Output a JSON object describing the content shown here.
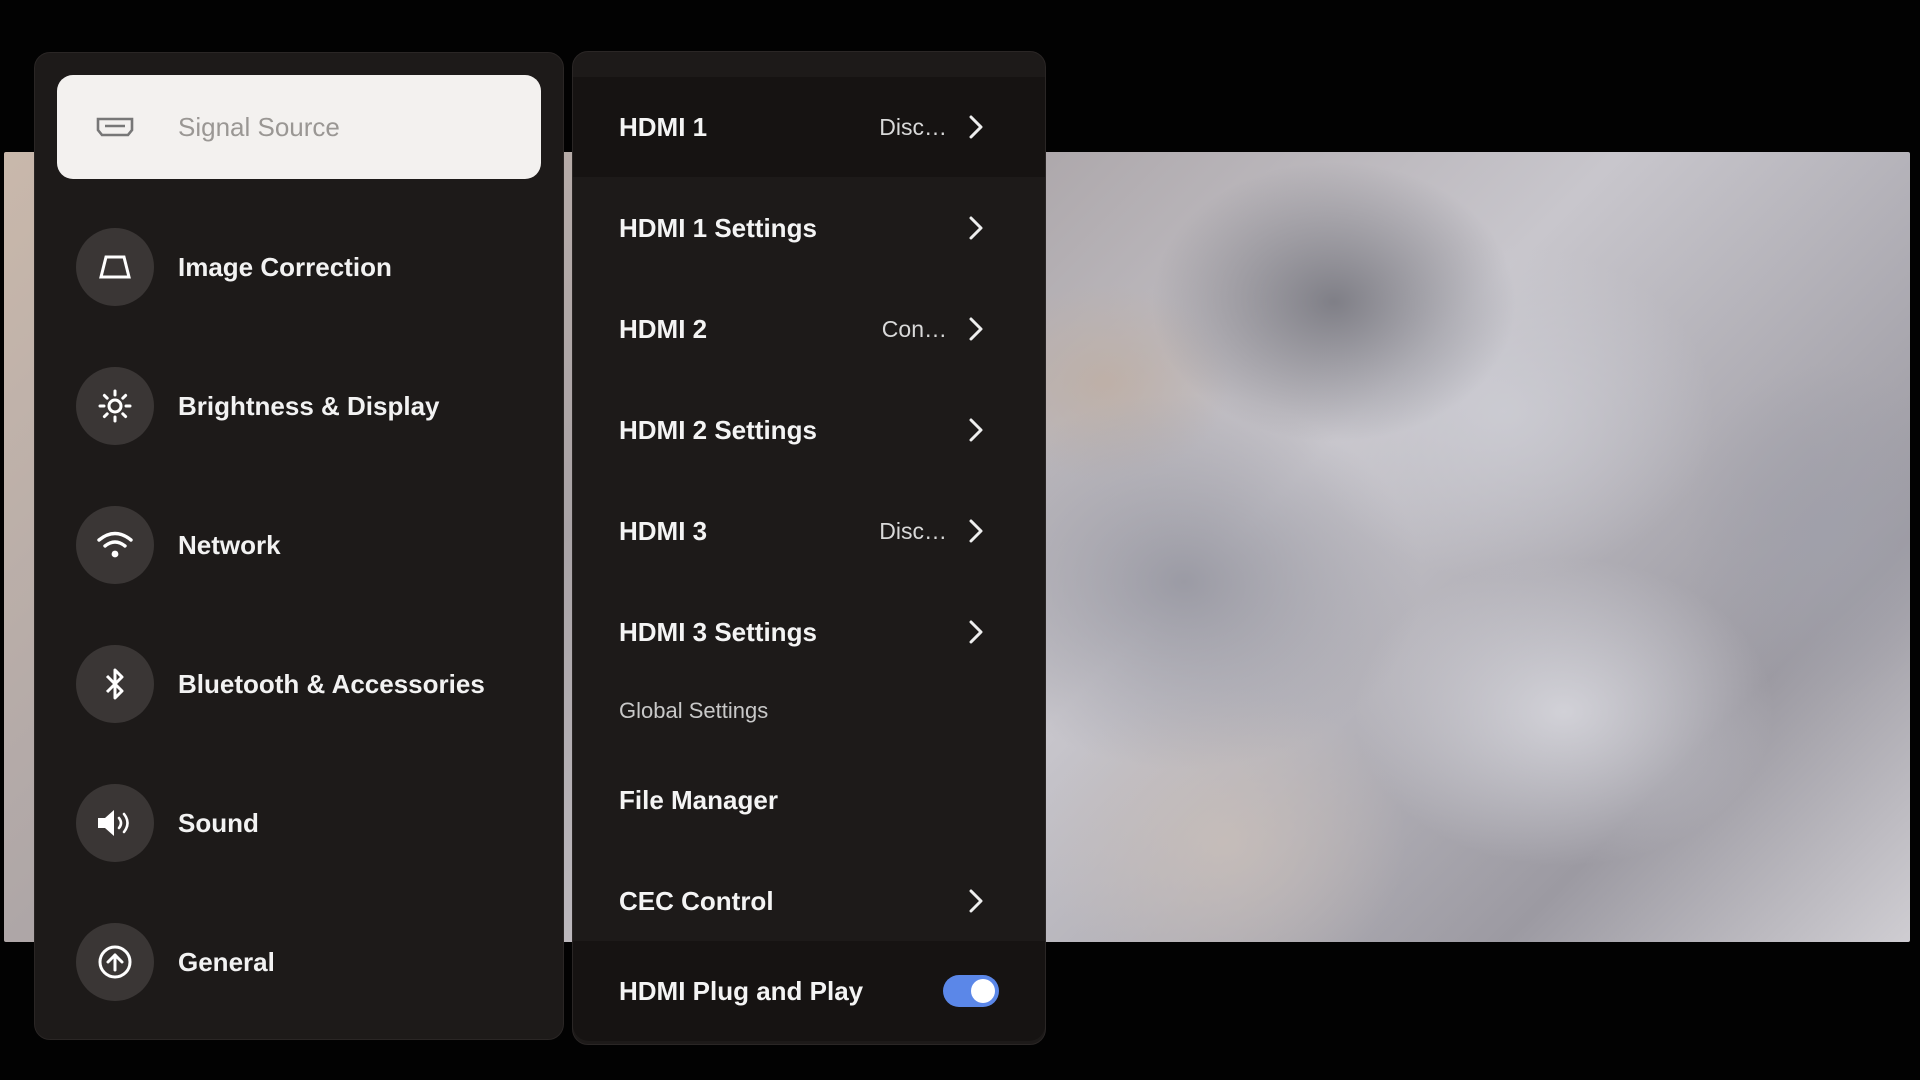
{
  "sidebar": {
    "items": [
      {
        "label": "Signal Source",
        "icon": "hdmi-port-icon",
        "selected": true
      },
      {
        "label": "Image Correction",
        "icon": "trapezoid-icon"
      },
      {
        "label": "Brightness & Display",
        "icon": "sun-icon"
      },
      {
        "label": "Network",
        "icon": "wifi-icon"
      },
      {
        "label": "Bluetooth & Accessories",
        "icon": "bluetooth-icon"
      },
      {
        "label": "Sound",
        "icon": "speaker-icon"
      },
      {
        "label": "General",
        "icon": "upload-circle-icon"
      }
    ]
  },
  "source_menu": {
    "rows": [
      {
        "label": "HDMI 1",
        "value": "Disc…"
      },
      {
        "label": "HDMI 1 Settings",
        "value": ""
      },
      {
        "label": "HDMI 2",
        "value": "Con…"
      },
      {
        "label": "HDMI 2 Settings",
        "value": ""
      },
      {
        "label": "HDMI 3",
        "value": "Disc…"
      },
      {
        "label": "HDMI 3 Settings",
        "value": ""
      }
    ],
    "section_label": "Global Settings",
    "global_rows": [
      {
        "label": "File Manager"
      },
      {
        "label": "CEC Control"
      },
      {
        "label": "HDMI Plug and Play",
        "toggle_on": true
      }
    ]
  },
  "colors": {
    "panel_bg": "#1d1a19",
    "selected_bg": "#f3f1ef",
    "toggle_accent": "#5b87e8"
  }
}
